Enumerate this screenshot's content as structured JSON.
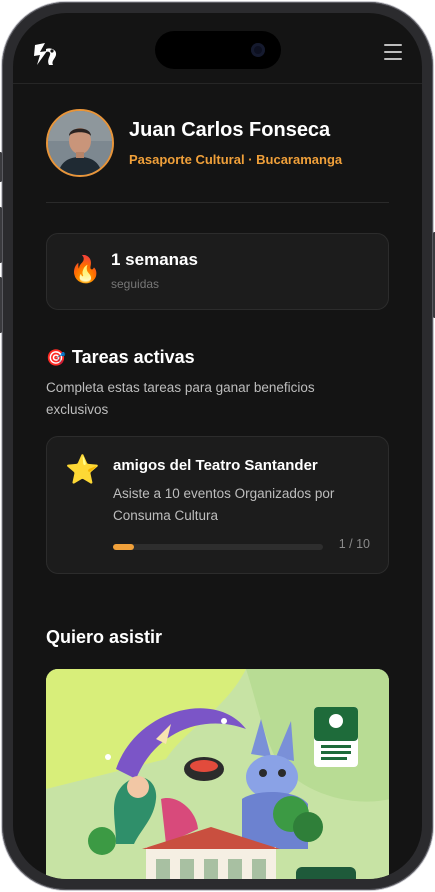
{
  "profile": {
    "name": "Juan Carlos Fonseca",
    "subtitle": "Pasaporte Cultural · Bucaramanga"
  },
  "streak": {
    "icon": "fire-icon",
    "value": "1 semanas",
    "label": "seguidas"
  },
  "tasks": {
    "icon": "target-icon",
    "title": "Tareas activas",
    "description": "Completa estas tareas para ganar beneficios exclusivos",
    "items": [
      {
        "icon": "star-icon",
        "title": "amigos del Teatro Santander",
        "description": "Asiste a 10 eventos Organizados por Consuma Cultura",
        "progress": 0.1,
        "count": "1 / 10"
      }
    ]
  },
  "events": {
    "title": "Quiero asistir"
  },
  "colors": {
    "accent": "#f0a03a",
    "background": "#141414",
    "card": "#1c1c1c"
  }
}
